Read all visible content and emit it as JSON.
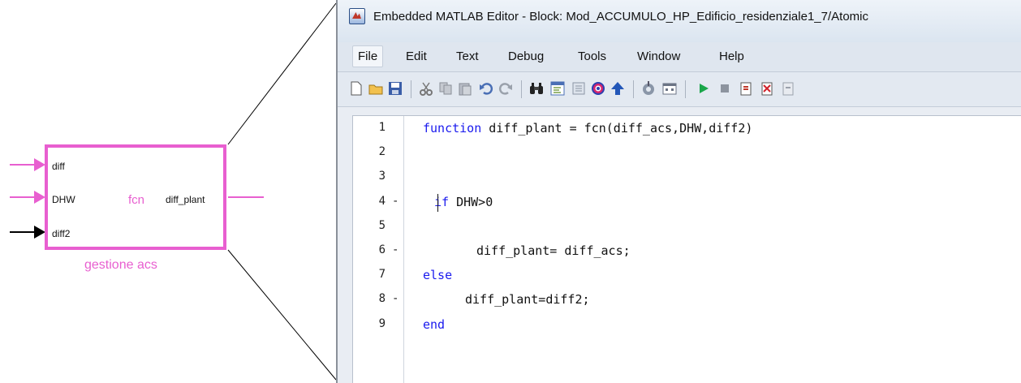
{
  "block": {
    "inputs": [
      "diff",
      "DHW",
      "diff2"
    ],
    "output": "diff_plant",
    "function_label": "fcn",
    "caption": "gestione acs",
    "colors": {
      "block": "#e85fd0",
      "arrow_active": "#e85fd0",
      "arrow_plain": "#000000"
    }
  },
  "editor": {
    "title": "Embedded MATLAB Editor - Block: Mod_ACCUMULO_HP_Edificio_residenziale1_7/Atomic",
    "menu": [
      "File",
      "Edit",
      "Text",
      "Debug",
      "Tools",
      "Window",
      "Help"
    ],
    "toolbar_icons": [
      "new-file-icon",
      "open-folder-icon",
      "save-icon",
      "cut-icon",
      "copy-icon",
      "paste-icon",
      "undo-icon",
      "redo-icon",
      "find-icon",
      "explorer-icon",
      "model-icon",
      "target-icon",
      "up-arrow-icon",
      "build-icon",
      "ports-icon",
      "run-icon",
      "stop-icon",
      "step-in-icon",
      "step-out-icon",
      "step-icon"
    ],
    "lines": [
      {
        "num": "1",
        "dash": "",
        "keyword": "function",
        "rest": " diff_plant = fcn(diff_acs,DHW,diff2)",
        "indent": 0
      },
      {
        "num": "2",
        "dash": "",
        "keyword": "",
        "rest": "",
        "indent": 0
      },
      {
        "num": "3",
        "dash": "",
        "keyword": "",
        "rest": "",
        "indent": 0
      },
      {
        "num": "4",
        "dash": "-",
        "keyword": "if",
        "rest": " DHW>0",
        "indent": 1
      },
      {
        "num": "5",
        "dash": "",
        "keyword": "",
        "rest": "",
        "indent": 0
      },
      {
        "num": "6",
        "dash": "-",
        "keyword": "",
        "rest": "diff_plant= diff_acs;",
        "indent": 2
      },
      {
        "num": "7",
        "dash": "",
        "keyword": "else",
        "rest": "",
        "indent": 0
      },
      {
        "num": "8",
        "dash": "-",
        "keyword": "",
        "rest": "diff_plant=diff2;",
        "indent": 3
      },
      {
        "num": "9",
        "dash": "",
        "keyword": "end",
        "rest": "",
        "indent": 0
      }
    ]
  }
}
